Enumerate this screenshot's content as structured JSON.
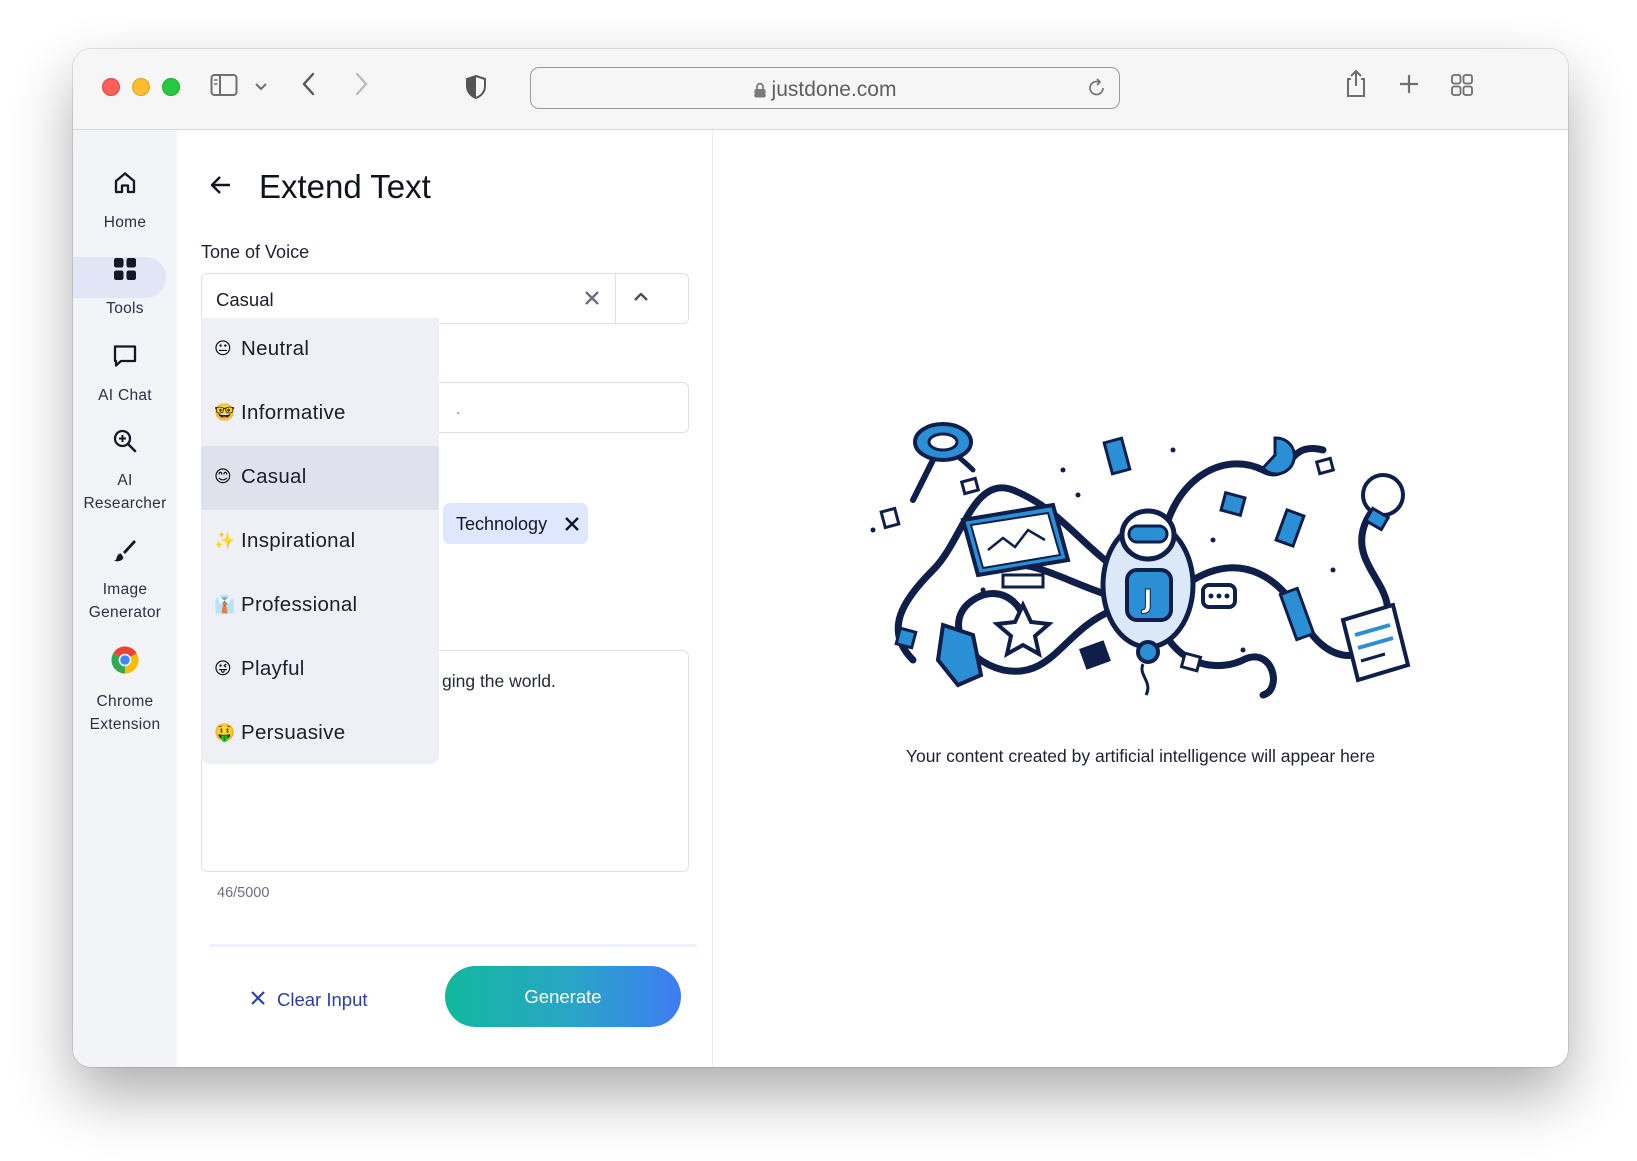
{
  "browser": {
    "url": "justdone.com"
  },
  "sidebar": {
    "items": [
      {
        "label": "Home",
        "icon": "home-icon"
      },
      {
        "label": "Tools",
        "icon": "grid-icon",
        "active": true
      },
      {
        "label": "AI Chat",
        "icon": "chat-icon"
      },
      {
        "label_line1": "AI",
        "label_line2": "Researcher",
        "icon": "magnifier-icon"
      },
      {
        "label_line1": "Image",
        "label_line2": "Generator",
        "icon": "brush-icon"
      },
      {
        "label_line1": "Chrome",
        "label_line2": "Extension",
        "icon": "chrome-icon"
      }
    ]
  },
  "panel": {
    "title": "Extend Text",
    "tone_label": "Tone of Voice",
    "tone_value": "Casual",
    "second_field_visible_fragment": ".",
    "keyword_chip": "Technology",
    "textarea_visible_fragment": "ging the world.",
    "char_count": "46/5000",
    "clear_label": "Clear Input",
    "generate_label": "Generate"
  },
  "dropdown": {
    "options": [
      {
        "emoji": "😐",
        "label": "Neutral"
      },
      {
        "emoji": "🤓",
        "label": "Informative"
      },
      {
        "emoji": "😊",
        "label": "Casual",
        "selected": true
      },
      {
        "emoji": "✨",
        "label": "Inspirational"
      },
      {
        "emoji": "👔",
        "label": "Professional"
      },
      {
        "emoji": "😜",
        "label": "Playful"
      },
      {
        "emoji": "🤑",
        "label": "Persuasive"
      }
    ]
  },
  "output": {
    "placeholder": "Your content created by artificial intelligence will appear here"
  },
  "colors": {
    "accent": "#2c3ea8",
    "chip_bg": "#dfe6ff",
    "gradient_start": "#11b89d",
    "gradient_end": "#3e7cf2",
    "illustration_navy": "#0f1f4a",
    "illustration_blue": "#2b8fd6"
  }
}
